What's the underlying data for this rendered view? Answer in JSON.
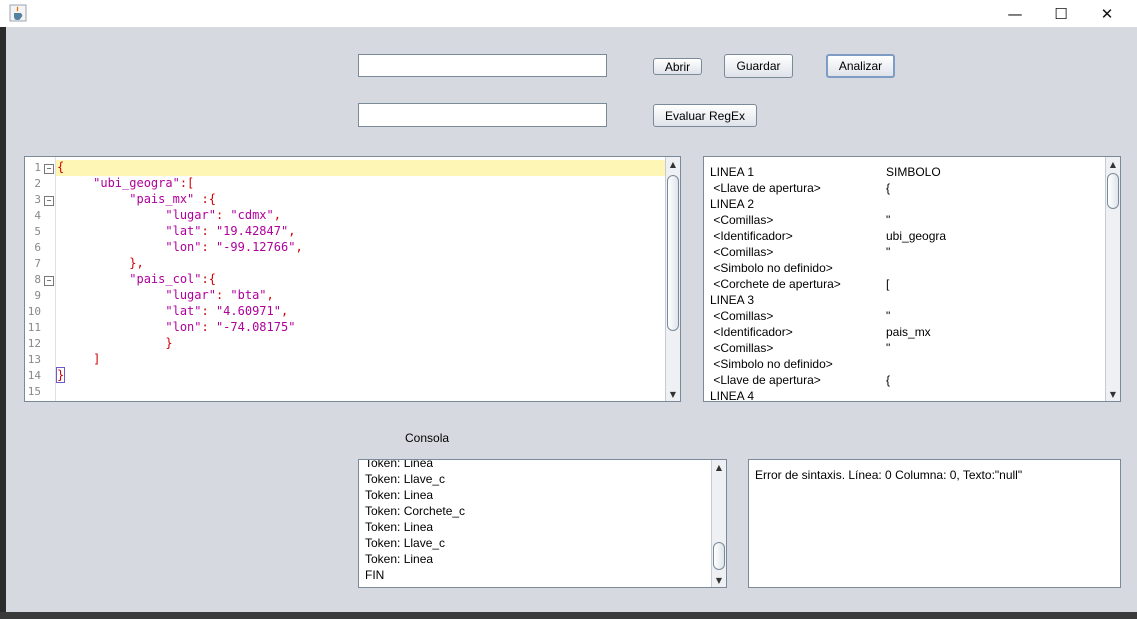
{
  "window": {
    "minimize_glyph": "—",
    "maximize_glyph": "☐",
    "close_glyph": "✕"
  },
  "toolbar": {
    "regex_value": "",
    "file_value": "",
    "open_label": "Abrir",
    "save_label": "Guardar",
    "analyze_label": "Analizar",
    "eval_regex_label": "Evaluar RegEx"
  },
  "editor": {
    "lines": [
      {
        "num": "1",
        "fold": true,
        "parts": [
          {
            "t": "{",
            "c": "red"
          }
        ]
      },
      {
        "num": "2",
        "fold": false,
        "parts": [
          {
            "t": "     ",
            "c": ""
          },
          {
            "t": "\"ubi_geogra\"",
            "c": "mag"
          },
          {
            "t": ":[",
            "c": "red"
          }
        ]
      },
      {
        "num": "3",
        "fold": true,
        "parts": [
          {
            "t": "          ",
            "c": ""
          },
          {
            "t": "\"pais_mx\"",
            "c": "mag"
          },
          {
            "t": " :{",
            "c": "red"
          }
        ]
      },
      {
        "num": "4",
        "fold": false,
        "parts": [
          {
            "t": "               ",
            "c": ""
          },
          {
            "t": "\"lugar\"",
            "c": "mag"
          },
          {
            "t": ": ",
            "c": "red"
          },
          {
            "t": "\"cdmx\"",
            "c": "mag"
          },
          {
            "t": ",",
            "c": "red"
          }
        ]
      },
      {
        "num": "5",
        "fold": false,
        "parts": [
          {
            "t": "               ",
            "c": ""
          },
          {
            "t": "\"lat\"",
            "c": "mag"
          },
          {
            "t": ": ",
            "c": "red"
          },
          {
            "t": "\"19.42847\"",
            "c": "mag"
          },
          {
            "t": ",",
            "c": "red"
          }
        ]
      },
      {
        "num": "6",
        "fold": false,
        "parts": [
          {
            "t": "               ",
            "c": ""
          },
          {
            "t": "\"lon\"",
            "c": "mag"
          },
          {
            "t": ": ",
            "c": "red"
          },
          {
            "t": "\"-99.12766\"",
            "c": "mag"
          },
          {
            "t": ",",
            "c": "red"
          }
        ]
      },
      {
        "num": "7",
        "fold": false,
        "parts": [
          {
            "t": "          ",
            "c": ""
          },
          {
            "t": "},",
            "c": "red"
          }
        ]
      },
      {
        "num": "8",
        "fold": true,
        "parts": [
          {
            "t": "          ",
            "c": ""
          },
          {
            "t": "\"pais_col\"",
            "c": "mag"
          },
          {
            "t": ":{",
            "c": "red"
          }
        ]
      },
      {
        "num": "9",
        "fold": false,
        "parts": [
          {
            "t": "               ",
            "c": ""
          },
          {
            "t": "\"lugar\"",
            "c": "mag"
          },
          {
            "t": ": ",
            "c": "red"
          },
          {
            "t": "\"bta\"",
            "c": "mag"
          },
          {
            "t": ",",
            "c": "red"
          }
        ]
      },
      {
        "num": "10",
        "fold": false,
        "parts": [
          {
            "t": "               ",
            "c": ""
          },
          {
            "t": "\"lat\"",
            "c": "mag"
          },
          {
            "t": ": ",
            "c": "red"
          },
          {
            "t": "\"4.60971\"",
            "c": "mag"
          },
          {
            "t": ",",
            "c": "red"
          }
        ]
      },
      {
        "num": "11",
        "fold": false,
        "parts": [
          {
            "t": "               ",
            "c": ""
          },
          {
            "t": "\"lon\"",
            "c": "mag"
          },
          {
            "t": ": ",
            "c": "red"
          },
          {
            "t": "\"-74.08175\"",
            "c": "mag"
          }
        ]
      },
      {
        "num": "12",
        "fold": false,
        "parts": [
          {
            "t": "               ",
            "c": ""
          },
          {
            "t": "}",
            "c": "red"
          }
        ]
      },
      {
        "num": "13",
        "fold": false,
        "parts": [
          {
            "t": "     ",
            "c": ""
          },
          {
            "t": "]",
            "c": "red"
          }
        ]
      },
      {
        "num": "14",
        "fold": false,
        "parts": [
          {
            "t": "}",
            "c": "red",
            "cursor": true
          }
        ]
      },
      {
        "num": "15",
        "fold": false,
        "parts": []
      }
    ]
  },
  "tokens_panel": {
    "rows": [
      {
        "a": "LINEA 1",
        "b": "SIMBOLO"
      },
      {
        "a": " <Llave de apertura>",
        "b": "{"
      },
      {
        "a": "LINEA 2",
        "b": ""
      },
      {
        "a": " <Comillas>",
        "b": "\""
      },
      {
        "a": " <Identificador>",
        "b": "ubi_geogra"
      },
      {
        "a": " <Comillas>",
        "b": "\""
      },
      {
        "a": " <Simbolo no definido>",
        "b": ""
      },
      {
        "a": " <Corchete de apertura>",
        "b": "["
      },
      {
        "a": "LINEA 3",
        "b": ""
      },
      {
        "a": " <Comillas>",
        "b": "\""
      },
      {
        "a": " <Identificador>",
        "b": "pais_mx"
      },
      {
        "a": " <Comillas>",
        "b": "\""
      },
      {
        "a": " <Simbolo no definido>",
        "b": ""
      },
      {
        "a": " <Llave de apertura>",
        "b": "{"
      },
      {
        "a": "LINEA 4",
        "b": ""
      }
    ]
  },
  "console": {
    "label": "Consola",
    "lines": [
      "Token: Linea",
      "Token: Llave_c",
      "Token: Linea",
      "Token: Corchete_c",
      "Token: Linea",
      "Token: Llave_c",
      "Token: Linea",
      "FIN"
    ]
  },
  "errors": {
    "text": "Error de sintaxis. Línea: 0 Columna: 0, Texto:\"null\""
  },
  "icons": {
    "app": "java-cup-icon",
    "scroll_up": "▲",
    "scroll_down": "▼"
  }
}
